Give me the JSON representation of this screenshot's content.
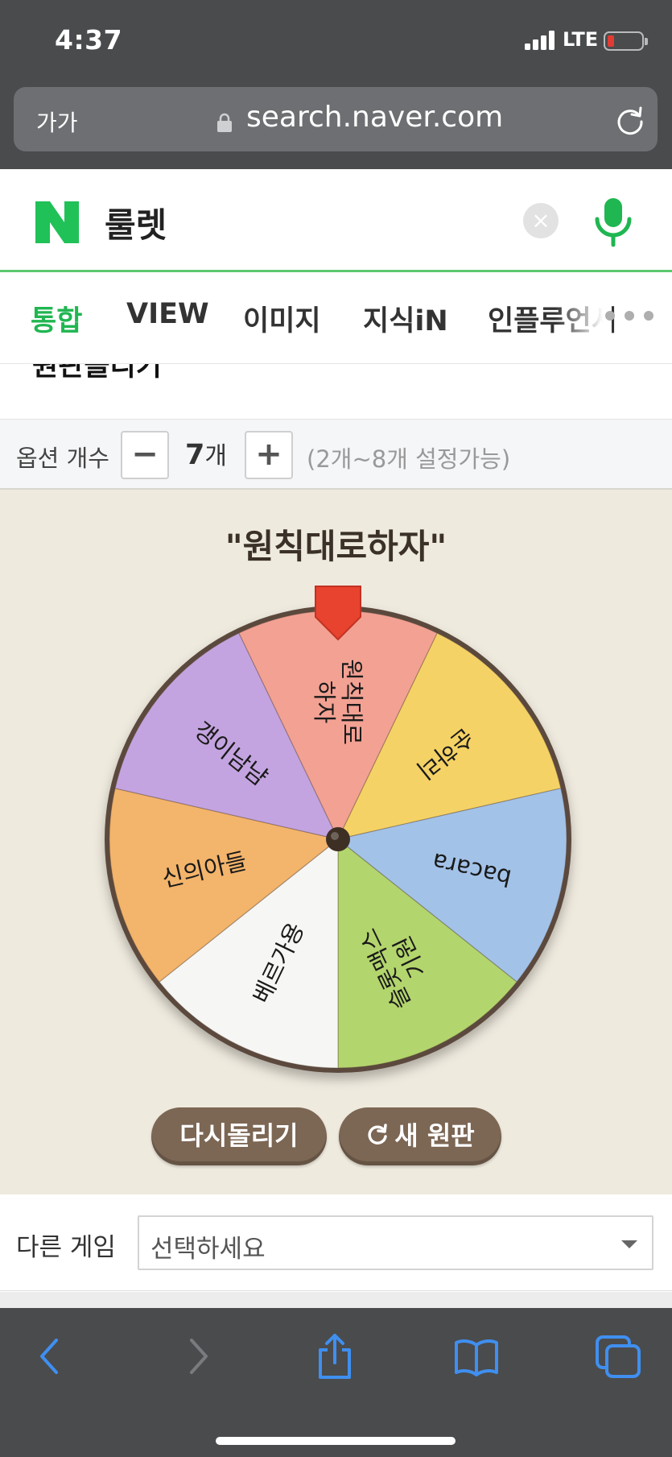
{
  "status_bar": {
    "time": "4:37",
    "network": "LTE"
  },
  "browser": {
    "text_size_label": "가가",
    "url": "search.naver.com"
  },
  "search": {
    "query": "룰렛"
  },
  "tabs": [
    {
      "label": "통합",
      "active": true
    },
    {
      "label": "VIEW",
      "active": false
    },
    {
      "label": "이미지",
      "active": false
    },
    {
      "label": "지식iN",
      "active": false
    },
    {
      "label": "인플루언서",
      "active": false
    }
  ],
  "section_title": "원판돌리기",
  "options": {
    "label": "옵션 개수",
    "minus": "−",
    "plus": "+",
    "count": "7",
    "count_unit": "개",
    "hint": "(2개~8개 설정가능)"
  },
  "roulette": {
    "result": "\"원칙대로하자\"",
    "segments": [
      {
        "lines": [
          "원칙대로",
          "하자"
        ],
        "color": "#f2a193"
      },
      {
        "lines": [
          "순하리"
        ],
        "color": "#f5d265"
      },
      {
        "lines": [
          "bacara"
        ],
        "color": "#a3c2e8"
      },
      {
        "lines": [
          "슬롯맥스",
          "기원"
        ],
        "color": "#b3d56d"
      },
      {
        "lines": [
          "베르가용"
        ],
        "color": "#f6f6f4"
      },
      {
        "lines": [
          "신의아들"
        ],
        "color": "#f3b46b"
      },
      {
        "lines": [
          "갱이남냠"
        ],
        "color": "#c4a4e0"
      }
    ],
    "pointer_color": "#e8432f",
    "rim_color": "#5b4a3d"
  },
  "buttons": {
    "respin": "다시돌리기",
    "new_wheel": "새 원판"
  },
  "other_game": {
    "label": "다른 게임",
    "select_value": "선택하세요"
  },
  "colors": {
    "naver_green": "#20b651",
    "button_brown": "#7c6654",
    "ios_blue": "#3f8ff0"
  }
}
